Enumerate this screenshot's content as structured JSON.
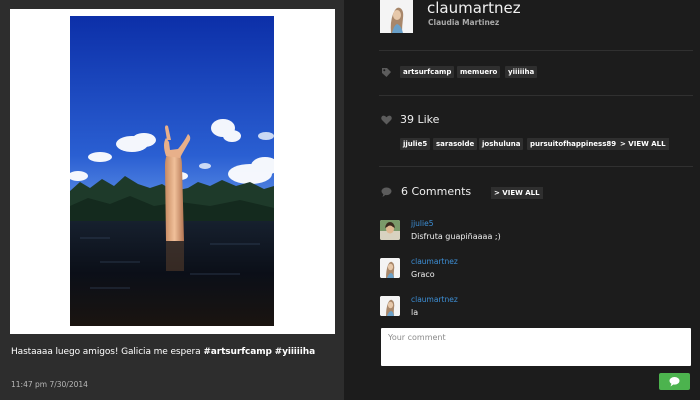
{
  "post": {
    "caption_text": "Hastaaaa luego amigos! Galicia me espera ",
    "caption_tags": [
      "#artsurfcamp",
      "#yiiiiiha"
    ],
    "timestamp": "11:47 pm 7/30/2014"
  },
  "author": {
    "username": "claumartnez",
    "full_name": "Claudia Martinez"
  },
  "tags": [
    "artsurfcamp",
    "memuero",
    "yiiiiiha"
  ],
  "likes": {
    "label": "39 Like",
    "users": [
      "jjulie5",
      "sarasolde",
      "joshuluna",
      "pursuitofhappiness89"
    ],
    "view_all": "> VIEW ALL"
  },
  "comments": {
    "label": "6 Comments",
    "view_all": "> VIEW ALL",
    "items": [
      {
        "user": "jjulie5",
        "text": "Disfruta guapiñaaaa ;)"
      },
      {
        "user": "claumartnez",
        "text": "Graco"
      },
      {
        "user": "claumartnez",
        "text": "la"
      }
    ],
    "input_placeholder": "Your comment"
  },
  "colors": {
    "accent_link": "#3d8fd6",
    "send_button": "#4cb34e",
    "panel_left": "#2d2d2d",
    "panel_right": "#1c1c1c"
  },
  "icons": {
    "tag": "tag-icon",
    "like": "heart-icon",
    "comment": "speech-bubble-icon",
    "send": "chat-bubble-icon"
  }
}
